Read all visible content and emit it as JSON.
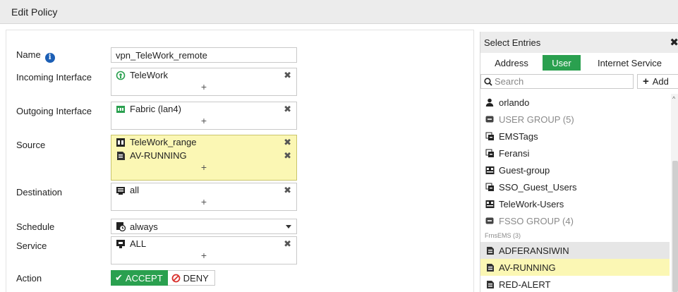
{
  "window": {
    "title": "Edit Policy"
  },
  "form": {
    "name_label": "Name",
    "name_value": "vpn_TeleWork_remote",
    "incoming_label": "Incoming Interface",
    "incoming_entries": [
      "TeleWork"
    ],
    "outgoing_label": "Outgoing Interface",
    "outgoing_entries": [
      "Fabric (lan4)"
    ],
    "source_label": "Source",
    "source_entries": [
      "TeleWork_range",
      "AV-RUNNING"
    ],
    "destination_label": "Destination",
    "destination_entries": [
      "all"
    ],
    "schedule_label": "Schedule",
    "schedule_value": "always",
    "service_label": "Service",
    "service_entries": [
      "ALL"
    ],
    "action_label": "Action",
    "accept_label": "ACCEPT",
    "deny_label": "DENY",
    "add_symbol": "+",
    "remove_symbol": "✖",
    "info_symbol": "i"
  },
  "side_panel": {
    "title": "Select Entries",
    "close_symbol": "✖",
    "tabs": [
      {
        "label": "Address",
        "active": false
      },
      {
        "label": "User",
        "active": true
      },
      {
        "label": "Internet Service",
        "active": false
      }
    ],
    "search_placeholder": "Search",
    "add_label": "Add",
    "items": [
      {
        "label": "orlando",
        "kind": "user"
      },
      {
        "label": "USER GROUP (5)",
        "kind": "group-header"
      },
      {
        "label": "EMSTags",
        "kind": "fsso-group"
      },
      {
        "label": "Feransi",
        "kind": "fsso-group"
      },
      {
        "label": "Guest-group",
        "kind": "user-group"
      },
      {
        "label": "SSO_Guest_Users",
        "kind": "fsso-group"
      },
      {
        "label": "TeleWork-Users",
        "kind": "user-group"
      },
      {
        "label": "FSSO GROUP (4)",
        "kind": "group-header"
      },
      {
        "label": "FrnsEMS (3)",
        "kind": "sub-header"
      },
      {
        "label": "ADFERANSIWIN",
        "kind": "ems-tag",
        "state": "hover"
      },
      {
        "label": "AV-RUNNING",
        "kind": "ems-tag",
        "state": "selected"
      },
      {
        "label": "RED-ALERT",
        "kind": "ems-tag"
      }
    ]
  },
  "colors": {
    "accent_green": "#2aa04f",
    "selected_yellow": "#fbf7b4",
    "header_grey": "#ececec",
    "info_blue": "#1c5fb5"
  }
}
